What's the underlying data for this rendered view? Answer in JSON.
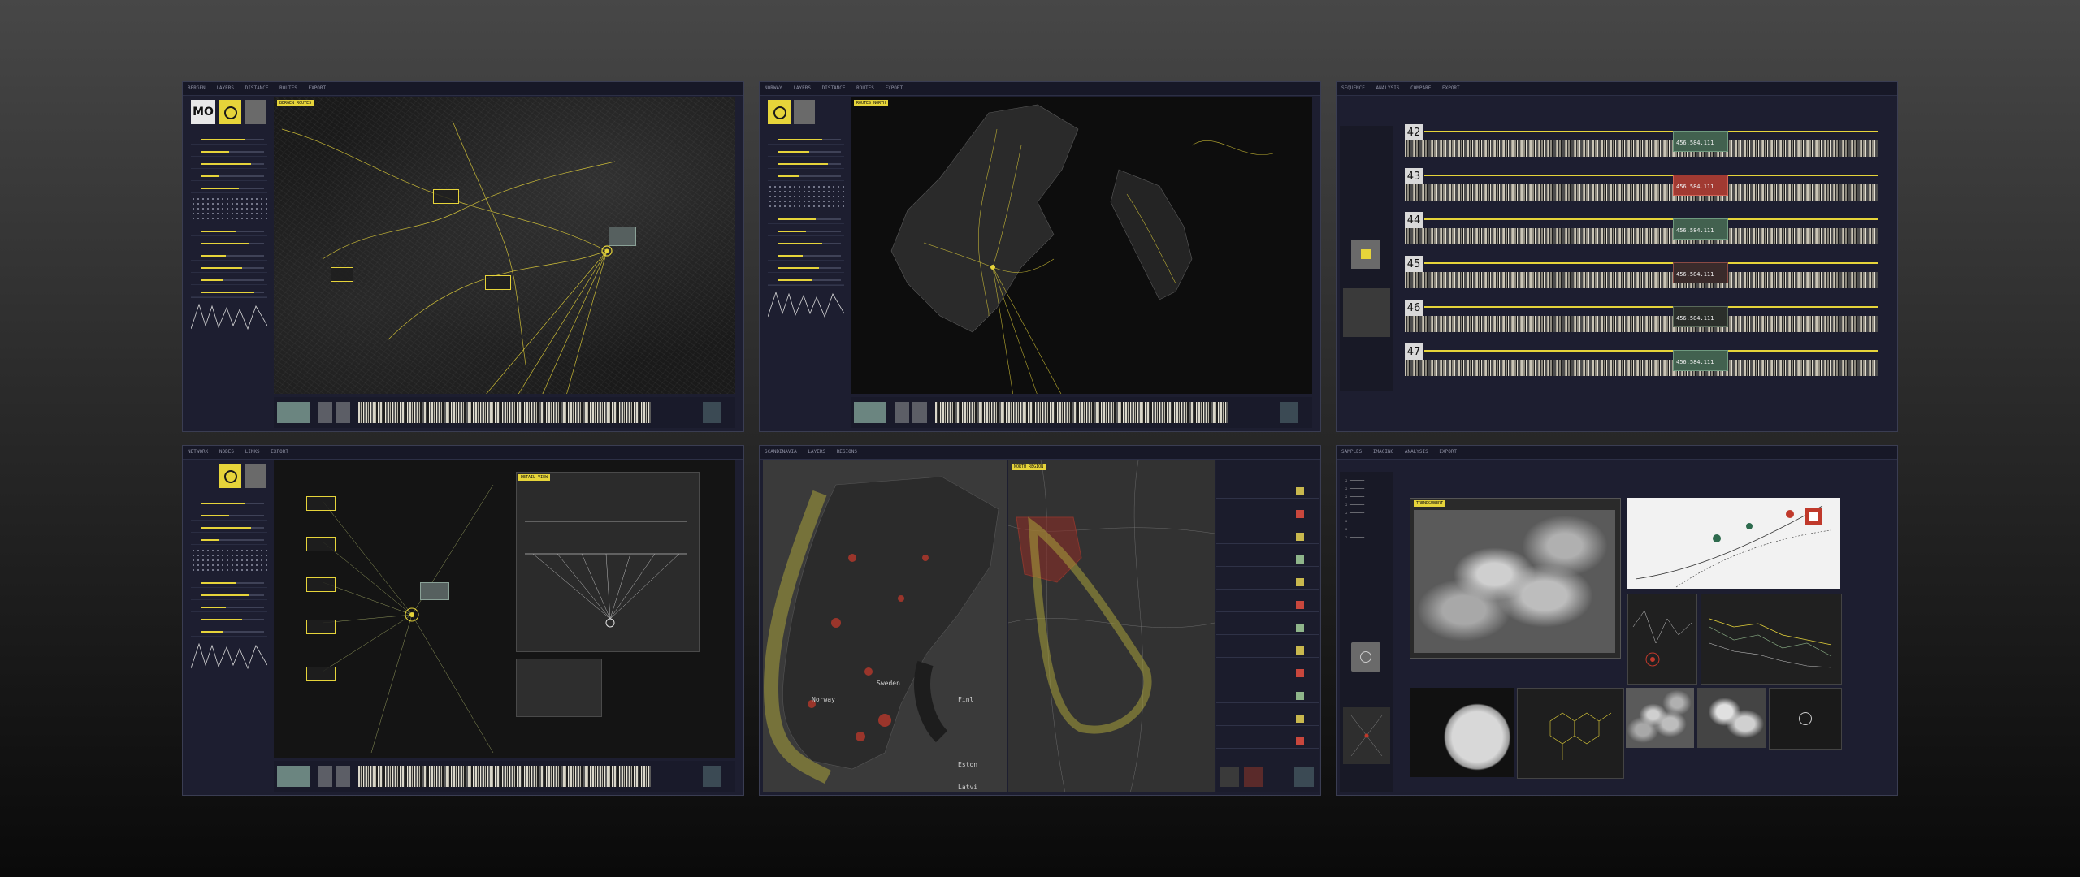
{
  "colors": {
    "accent": "#e6d43a",
    "panel": "#1d1e30",
    "alert_red": "#a13a32",
    "ok_green": "#42614f",
    "route_red": "#c0392b"
  },
  "panels": {
    "p1": {
      "top_items": [
        "BERGEN",
        "LAYERS",
        "DISTANCE",
        "ROUTES",
        "EXPORT"
      ],
      "logo": "MO",
      "tag": "BERGEN ROUTES"
    },
    "p2": {
      "top_items": [
        "NORWAY",
        "LAYERS",
        "DISTANCE",
        "ROUTES",
        "EXPORT"
      ],
      "tag": "ROUTES NORTH"
    },
    "p3": {
      "top_items": [
        "SEQUENCE",
        "ANALYSIS",
        "COMPARE",
        "EXPORT"
      ],
      "rows": [
        {
          "num": "42",
          "value": "456.584.111",
          "status": "ok"
        },
        {
          "num": "43",
          "value": "456.584.111",
          "status": "alert"
        },
        {
          "num": "44",
          "value": "456.584.111",
          "status": "ok"
        },
        {
          "num": "45",
          "value": "456.584.111",
          "status": "ok"
        },
        {
          "num": "46",
          "value": "456.584.111",
          "status": "ok"
        },
        {
          "num": "47",
          "value": "456.584.111",
          "status": "ok"
        }
      ]
    },
    "p4": {
      "top_items": [
        "NETWORK",
        "NODES",
        "LINKS",
        "EXPORT"
      ],
      "tag": "DETAIL VIEW"
    },
    "p5": {
      "top_items": [
        "SCANDINAVIA",
        "LAYERS",
        "REGIONS"
      ],
      "labels": [
        "Norway",
        "Sweden",
        "Finl",
        "Eston",
        "Latvi"
      ],
      "tag": "NORTH REGION"
    },
    "p6": {
      "top_items": [
        "SAMPLES",
        "IMAGING",
        "ANALYSIS",
        "EXPORT"
      ],
      "sample_tag": "TRENDGUBERT"
    }
  }
}
